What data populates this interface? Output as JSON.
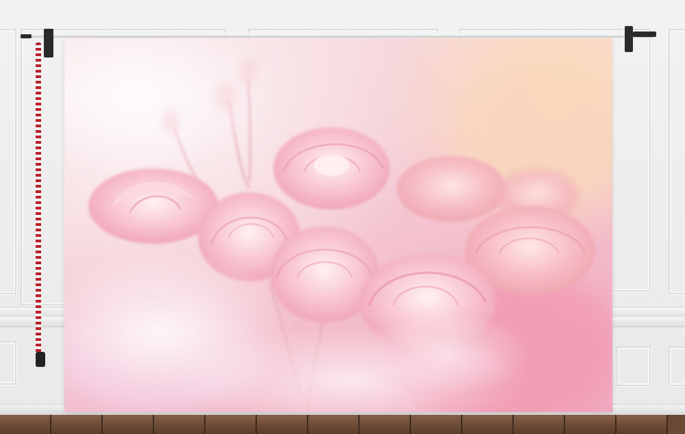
{
  "scene": {
    "subject": "roses",
    "colors": {
      "backdrop_base": "#f5cdd6",
      "rose_light": "#fbd9df",
      "rose_mid": "#f4b3c2",
      "rose_deep": "#ea8fa8",
      "glow": "#fde3b9",
      "wall": "#eeeeee",
      "floor": "#6b4a35",
      "chain_red": "#b8202a"
    },
    "icons": [
      "stand-clamp-icon",
      "chain-weight-icon"
    ]
  }
}
